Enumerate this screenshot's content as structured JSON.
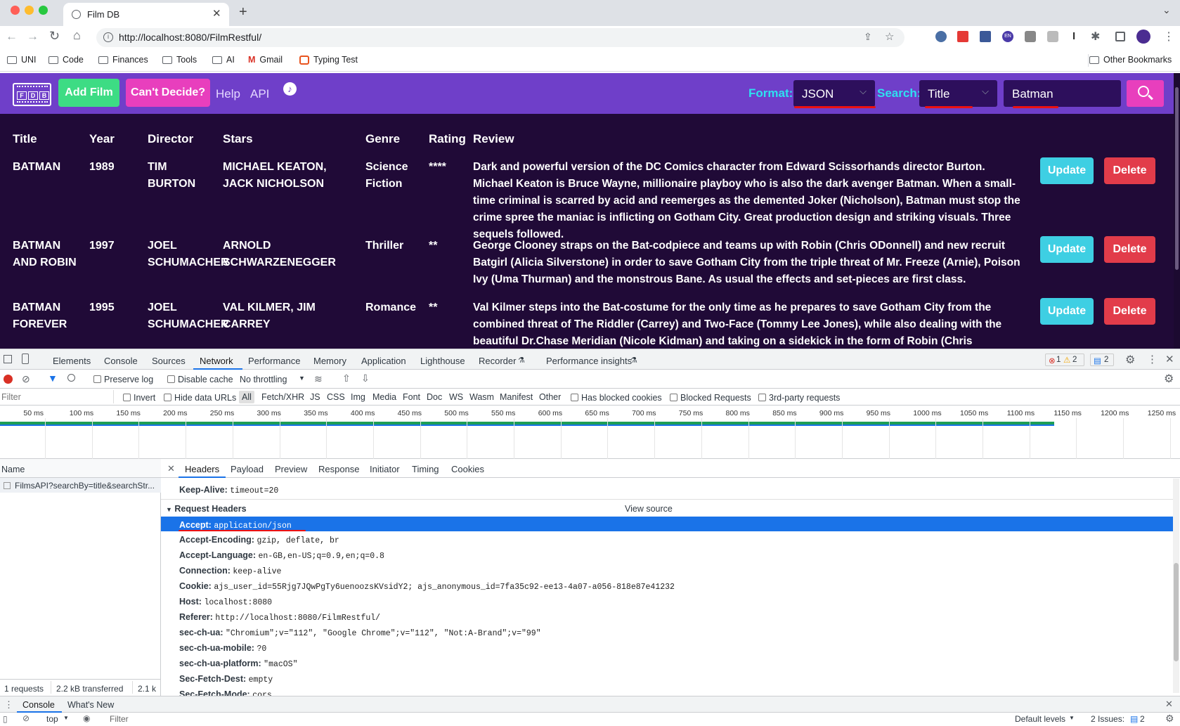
{
  "browser": {
    "tab_title": "Film DB",
    "url": "http://localhost:8080/FilmRestful/",
    "bookmarks": [
      "UNI",
      "Code",
      "Finances",
      "Tools",
      "AI",
      "Gmail",
      "Typing Test"
    ],
    "other_bookmarks": "Other Bookmarks",
    "ext_en": "EN"
  },
  "app": {
    "logo_letters": [
      "F",
      "D",
      "B"
    ],
    "add_film": "Add Film",
    "cant_decide": "Can't Decide?",
    "help": "Help",
    "api": "API",
    "format_label": "Format:",
    "format_value": "JSON",
    "search_label": "Search:",
    "search_by_value": "Title",
    "search_input_value": "Batman",
    "colors": {
      "navbar": "#6f3fc9",
      "content_bg": "#200a37",
      "add_film": "#3ddc84",
      "cant_decide": "#e83fbd",
      "update": "#3ecfe3",
      "delete": "#e23c4a",
      "search_btn": "#e83fbd"
    }
  },
  "table": {
    "headers": [
      "Title",
      "Year",
      "Director",
      "Stars",
      "Genre",
      "Rating",
      "Review"
    ],
    "rows": [
      {
        "title": "BATMAN",
        "year": "1989",
        "director": "TIM BURTON",
        "stars": "MICHAEL KEATON, JACK NICHOLSON",
        "genre": "Science Fiction",
        "rating": "****",
        "review": "Dark and powerful version of the DC Comics character from Edward Scissorhands director Burton. Michael Keaton is Bruce Wayne, millionaire playboy who is also the dark avenger Batman. When a small-time criminal is scarred by acid and reemerges as the demented Joker (Nicholson), Batman must stop the crime spree the maniac is inflicting on Gotham City. Great production design and striking visuals. Three sequels followed.",
        "update": "Update",
        "delete": "Delete"
      },
      {
        "title": "BATMAN AND ROBIN",
        "year": "1997",
        "director": "JOEL SCHUMACHER",
        "stars": "ARNOLD SCHWARZENEGGER",
        "genre": "Thriller",
        "rating": "**",
        "review": "George Clooney straps on the Bat-codpiece and teams up with Robin (Chris ODonnell) and new recruit Batgirl (Alicia Silverstone) in order to save Gotham City from the triple threat of Mr. Freeze (Arnie), Poison Ivy (Uma Thurman) and the monstrous Bane. As usual the effects and set-pieces are first class.",
        "update": "Update",
        "delete": "Delete"
      },
      {
        "title": "BATMAN FOREVER",
        "year": "1995",
        "director": "JOEL SCHUMACHER",
        "stars": "VAL KILMER, JIM CARREY",
        "genre": "Romance",
        "rating": "**",
        "review": "Val Kilmer steps into the Bat-costume for the only time as he prepares to save Gotham City from the combined threat of The Riddler (Carrey) and Two-Face (Tommy Lee Jones), while also dealing with the beautiful Dr.Chase Meridian (Nicole Kidman) and taking on a sidekick in the form of Robin (Chris ODonnell).",
        "update": "Update",
        "delete": "Delete"
      }
    ]
  },
  "devtools": {
    "tabs": [
      "Elements",
      "Console",
      "Sources",
      "Network",
      "Performance",
      "Memory",
      "Application",
      "Lighthouse",
      "Recorder",
      "Performance insights"
    ],
    "active_tab": "Network",
    "error_count": "1",
    "warning_count": "2",
    "info_count": "2",
    "preserve_log": "Preserve log",
    "disable_cache": "Disable cache",
    "throttling": "No throttling",
    "filter_placeholder": "Filter",
    "invert": "Invert",
    "hide_data_urls": "Hide data URLs",
    "type_filters": [
      "All",
      "Fetch/XHR",
      "JS",
      "CSS",
      "Img",
      "Media",
      "Font",
      "Doc",
      "WS",
      "Wasm",
      "Manifest",
      "Other"
    ],
    "has_blocked_cookies": "Has blocked cookies",
    "blocked_requests": "Blocked Requests",
    "third_party": "3rd-party requests",
    "timeline_ticks": [
      "50 ms",
      "100 ms",
      "150 ms",
      "200 ms",
      "250 ms",
      "300 ms",
      "350 ms",
      "400 ms",
      "450 ms",
      "500 ms",
      "550 ms",
      "600 ms",
      "650 ms",
      "700 ms",
      "750 ms",
      "800 ms",
      "850 ms",
      "900 ms",
      "950 ms",
      "1000 ms",
      "1050 ms",
      "1100 ms",
      "1150 ms",
      "1200 ms",
      "1250 ms"
    ],
    "name_col": "Name",
    "request_name": "FilmsAPI?searchBy=title&searchStr...",
    "detail_tabs": [
      "Headers",
      "Payload",
      "Preview",
      "Response",
      "Initiator",
      "Timing",
      "Cookies"
    ],
    "keep_alive_key": "Keep-Alive:",
    "keep_alive_val": "timeout=20",
    "request_headers_title": "Request Headers",
    "view_source": "View source",
    "headers": [
      {
        "k": "Accept:",
        "v": "application/json"
      },
      {
        "k": "Accept-Encoding:",
        "v": "gzip, deflate, br"
      },
      {
        "k": "Accept-Language:",
        "v": "en-GB,en-US;q=0.9,en;q=0.8"
      },
      {
        "k": "Connection:",
        "v": "keep-alive"
      },
      {
        "k": "Cookie:",
        "v": "ajs_user_id=55Rjg7JQwPgTy6uenoozsKVsidY2; ajs_anonymous_id=7fa35c92-ee13-4a07-a056-818e87e41232"
      },
      {
        "k": "Host:",
        "v": "localhost:8080"
      },
      {
        "k": "Referer:",
        "v": "http://localhost:8080/FilmRestful/"
      },
      {
        "k": "sec-ch-ua:",
        "v": "\"Chromium\";v=\"112\", \"Google Chrome\";v=\"112\", \"Not:A-Brand\";v=\"99\""
      },
      {
        "k": "sec-ch-ua-mobile:",
        "v": "?0"
      },
      {
        "k": "sec-ch-ua-platform:",
        "v": "\"macOS\""
      },
      {
        "k": "Sec-Fetch-Dest:",
        "v": "empty"
      },
      {
        "k": "Sec-Fetch-Mode:",
        "v": "cors"
      }
    ],
    "summary_requests": "1 requests",
    "summary_transferred": "2.2 kB transferred",
    "summary_resources": "2.1 k",
    "drawer_tabs": [
      "Console",
      "What's New"
    ],
    "console_context": "top",
    "console_filter": "Filter",
    "default_levels": "Default levels",
    "issues_label": "2 Issues:",
    "issues_count": "2"
  }
}
